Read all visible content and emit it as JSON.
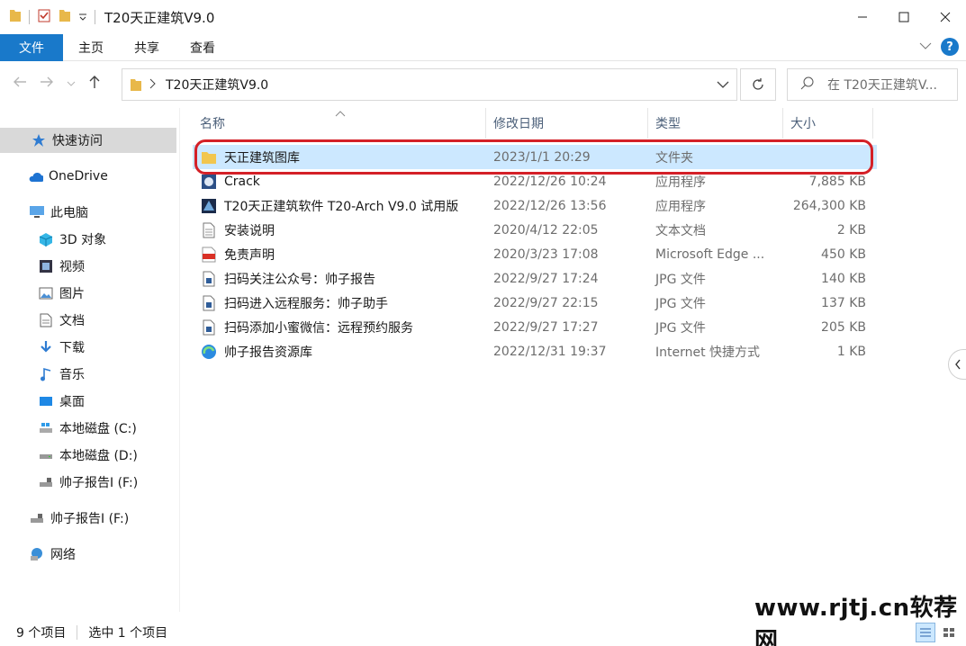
{
  "window": {
    "title": "T20天正建筑V9.0"
  },
  "ribbon": {
    "tabs": [
      "文件",
      "主页",
      "共享",
      "查看"
    ]
  },
  "address": {
    "crumb": "T20天正建筑V9.0",
    "search_placeholder": "在 T20天正建筑V..."
  },
  "sidebar": {
    "items": [
      {
        "label": "快速访问",
        "icon": "star-icon"
      },
      {
        "label": "OneDrive",
        "icon": "cloud-icon"
      },
      {
        "label": "此电脑",
        "icon": "computer-icon"
      },
      {
        "label": "3D 对象",
        "icon": "cube-icon"
      },
      {
        "label": "视频",
        "icon": "video-icon"
      },
      {
        "label": "图片",
        "icon": "picture-icon"
      },
      {
        "label": "文档",
        "icon": "document-icon"
      },
      {
        "label": "下载",
        "icon": "download-icon"
      },
      {
        "label": "音乐",
        "icon": "music-icon"
      },
      {
        "label": "桌面",
        "icon": "desktop-icon"
      },
      {
        "label": "本地磁盘 (C:)",
        "icon": "drive-icon"
      },
      {
        "label": "本地磁盘 (D:)",
        "icon": "drive-icon"
      },
      {
        "label": "帅子报告I (F:)",
        "icon": "usb-drive-icon"
      },
      {
        "label": "帅子报告I (F:)",
        "icon": "usb-drive-icon"
      },
      {
        "label": "网络",
        "icon": "network-icon"
      }
    ]
  },
  "columns": {
    "name": "名称",
    "modified": "修改日期",
    "type": "类型",
    "size": "大小"
  },
  "files": [
    {
      "name": "天正建筑图库",
      "modified": "2023/1/1 20:29",
      "type": "文件夹",
      "size": "",
      "icon": "folder-icon"
    },
    {
      "name": "Crack",
      "modified": "2022/12/26 10:24",
      "type": "应用程序",
      "size": "7,885 KB",
      "icon": "app-icon"
    },
    {
      "name": "T20天正建筑软件 T20-Arch V9.0 试用版",
      "modified": "2022/12/26 13:56",
      "type": "应用程序",
      "size": "264,300 KB",
      "icon": "installer-icon"
    },
    {
      "name": "安装说明",
      "modified": "2020/4/12 22:05",
      "type": "文本文档",
      "size": "2 KB",
      "icon": "text-file-icon"
    },
    {
      "name": "免责声明",
      "modified": "2020/3/23 17:08",
      "type": "Microsoft Edge ...",
      "size": "450 KB",
      "icon": "pdf-icon"
    },
    {
      "name": "扫码关注公众号：帅子报告",
      "modified": "2022/9/27 17:24",
      "type": "JPG 文件",
      "size": "140 KB",
      "icon": "image-file-icon"
    },
    {
      "name": "扫码进入远程服务：帅子助手",
      "modified": "2022/9/27 22:15",
      "type": "JPG 文件",
      "size": "137 KB",
      "icon": "image-file-icon"
    },
    {
      "name": "扫码添加小蜜微信：远程预约服务",
      "modified": "2022/9/27 17:27",
      "type": "JPG 文件",
      "size": "205 KB",
      "icon": "image-file-icon"
    },
    {
      "name": "帅子报告资源库",
      "modified": "2022/12/31 19:37",
      "type": "Internet 快捷方式",
      "size": "1 KB",
      "icon": "edge-shortcut-icon"
    }
  ],
  "status": {
    "count": "9 个项目",
    "selected": "选中 1 个项目"
  },
  "watermark": "www.rjtj.cn软荐网",
  "colors": {
    "accent": "#1979ca",
    "selection": "#cce8ff",
    "highlight": "#d42027"
  }
}
